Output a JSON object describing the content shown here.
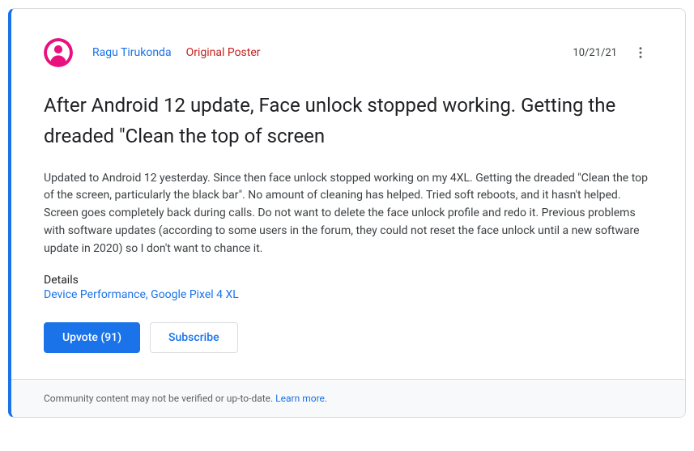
{
  "header": {
    "author": "Ragu Tirukonda",
    "badge": "Original Poster",
    "date": "10/21/21"
  },
  "post": {
    "title": "After Android 12 update, Face unlock stopped working. Getting the dreaded \"Clean the top of screen",
    "body": "Updated to Android 12 yesterday. Since then face unlock stopped working on my 4XL. Getting the dreaded \"Clean the top of the screen, particularly  the black bar\". No amount of cleaning has helped. Tried soft reboots, and it hasn't helped. Screen goes completely back during calls. Do not want to delete the face unlock profile and redo it. Previous problems with software updates (according to some users in the forum, they could not reset the face unlock until a new software update in 2020) so I don't want to chance it."
  },
  "details": {
    "label": "Details",
    "category": "Device Performance",
    "separator": ", ",
    "device": "Google Pixel 4 XL"
  },
  "actions": {
    "upvote": "Upvote (91)",
    "subscribe": "Subscribe"
  },
  "footer": {
    "text": "Community content may not be verified or up-to-date. ",
    "link": "Learn more."
  }
}
